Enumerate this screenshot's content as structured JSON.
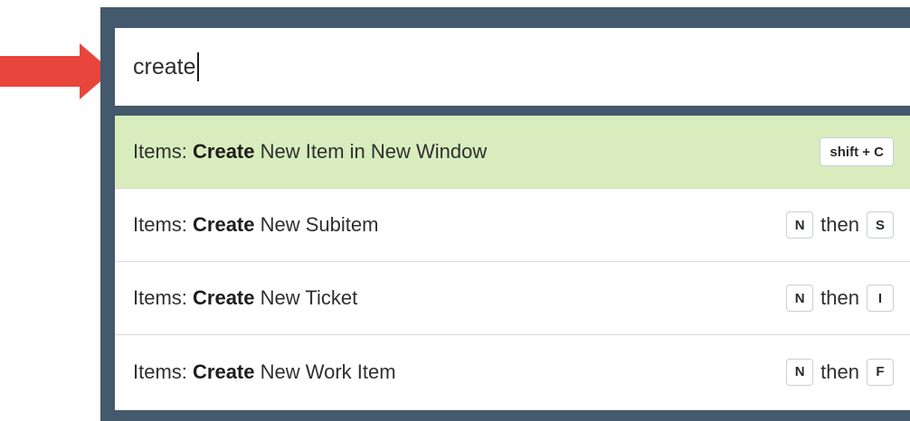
{
  "search": {
    "value": "create"
  },
  "results": [
    {
      "prefix": "Items: ",
      "match": "Create",
      "suffix": " New Item in New Window",
      "shortcut": {
        "keys": [
          "shift + C"
        ],
        "joiner": ""
      }
    },
    {
      "prefix": "Items: ",
      "match": "Create",
      "suffix": " New Subitem",
      "shortcut": {
        "keys": [
          "N",
          "S"
        ],
        "joiner": "then"
      }
    },
    {
      "prefix": "Items: ",
      "match": "Create",
      "suffix": " New Ticket",
      "shortcut": {
        "keys": [
          "N",
          "I"
        ],
        "joiner": "then"
      }
    },
    {
      "prefix": "Items: ",
      "match": "Create",
      "suffix": " New Work Item",
      "shortcut": {
        "keys": [
          "N",
          "F"
        ],
        "joiner": "then"
      }
    }
  ],
  "colors": {
    "frame": "#44596b",
    "highlight": "#d9ecbe",
    "arrow": "#e8453c"
  },
  "icons": {
    "pointer": "red-arrow-icon"
  }
}
